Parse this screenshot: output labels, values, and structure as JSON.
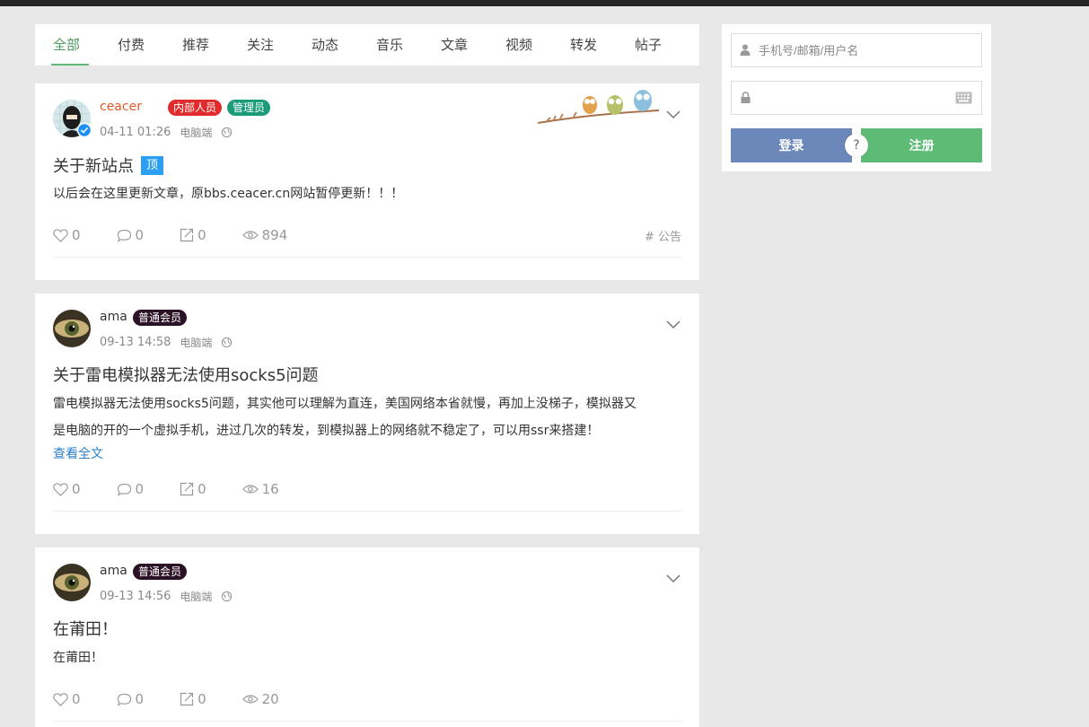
{
  "tabs": [
    {
      "label": "全部",
      "active": true
    },
    {
      "label": "付费"
    },
    {
      "label": "推荐"
    },
    {
      "label": "关注"
    },
    {
      "label": "动态"
    },
    {
      "label": "音乐"
    },
    {
      "label": "文章"
    },
    {
      "label": "视频"
    },
    {
      "label": "转发"
    },
    {
      "label": "帖子"
    }
  ],
  "posts": [
    {
      "username": "ceacer",
      "badges": [
        {
          "label": "内部人员",
          "color": "#e02c2c"
        },
        {
          "label": "管理员",
          "color": "#1a9b7a"
        }
      ],
      "time": "04-11 01:26",
      "device": "电脑端",
      "title": "关于新站点",
      "pin_label": "顶",
      "body": "以后会在这里更新文章，原bbs.ceacer.cn网站暂停更新！！！",
      "likes": "0",
      "comments": "0",
      "shares": "0",
      "views": "894",
      "tag": "# 公告"
    },
    {
      "username": "ama",
      "badges": [
        {
          "label": "普通会员",
          "color": "#2b1226"
        }
      ],
      "time": "09-13 14:58",
      "device": "电脑端",
      "title": "关于雷电模拟器无法使用socks5问题",
      "body_line1": "雷电模拟器无法使用socks5问题，其实他可以理解为直连，美国网络本省就慢，再加上没梯子，模拟器又",
      "body_line2": "是电脑的开的一个虚拟手机，进过几次的转发，到模拟器上的网络就不稳定了，可以用ssr来搭建！",
      "read_more": "查看全文",
      "likes": "0",
      "comments": "0",
      "shares": "0",
      "views": "16"
    },
    {
      "username": "ama",
      "badges": [
        {
          "label": "普通会员",
          "color": "#2b1226"
        }
      ],
      "time": "09-13 14:56",
      "device": "电脑端",
      "title": "在莆田！",
      "body": "在莆田！",
      "likes": "0",
      "comments": "0",
      "shares": "0",
      "views": "20"
    }
  ],
  "login": {
    "username_placeholder": "手机号/邮箱/用户名",
    "password_placeholder": "",
    "login_label": "登录",
    "help_label": "?",
    "register_label": "注册"
  },
  "colors": {
    "accent_green": "#5dbb75",
    "login_blue": "#6c87b9",
    "link_blue": "#2a7fc8",
    "ceacer_name": "#e05a2b"
  }
}
